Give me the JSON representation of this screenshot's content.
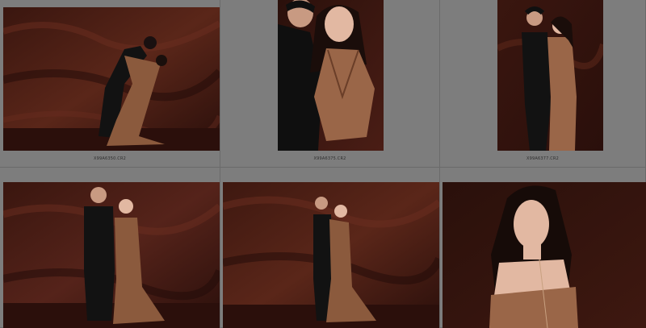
{
  "grid": {
    "cells": [
      {
        "filename": "X99A6350.CR2",
        "scene": "couple-dip"
      },
      {
        "filename": "X99A6375.CR2",
        "scene": "couple-closeup"
      },
      {
        "filename": "X99A6377.CR2",
        "scene": "couple-standing-hug"
      },
      {
        "filename": "",
        "scene": "couple-standing-side"
      },
      {
        "filename": "",
        "scene": "couple-embrace-full"
      },
      {
        "filename": "",
        "scene": "bride-portrait"
      }
    ]
  },
  "colors": {
    "panel_bg": "#7e7e7e",
    "backdrop_dark": "#2a0f0b",
    "backdrop_mid": "#4a1d15",
    "dress": "#8a5a3e",
    "suit": "#141414"
  }
}
